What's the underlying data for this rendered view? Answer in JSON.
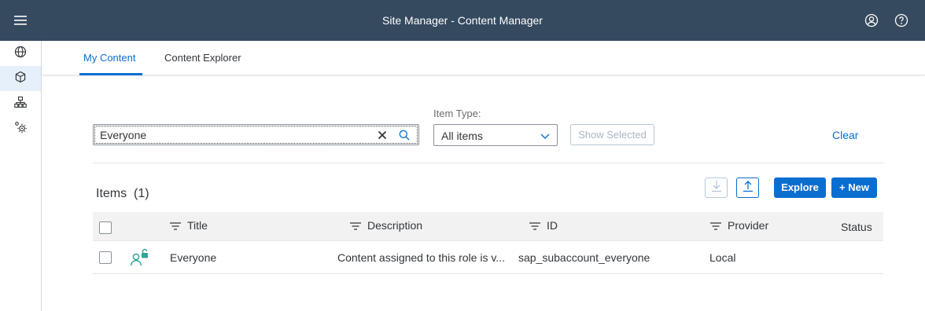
{
  "shell": {
    "title": "Site Manager - Content Manager"
  },
  "sidebar": {
    "items": [
      {
        "icon": "globe-icon",
        "active": false
      },
      {
        "icon": "cube-icon",
        "active": true
      },
      {
        "icon": "org-chart-icon",
        "active": false
      },
      {
        "icon": "settings-icon",
        "active": false
      }
    ]
  },
  "tabs": [
    {
      "label": "My Content",
      "active": true
    },
    {
      "label": "Content Explorer",
      "active": false
    }
  ],
  "filters": {
    "search_value": "Everyone",
    "item_type_label": "Item Type:",
    "item_type_value": "All items",
    "show_selected_label": "Show Selected",
    "clear_label": "Clear"
  },
  "items": {
    "title": "Items",
    "count": "(1)",
    "explore_label": "Explore",
    "new_label": "+ New"
  },
  "table": {
    "columns": [
      "Title",
      "Description",
      "ID",
      "Provider",
      "Status"
    ],
    "rows": [
      {
        "title": "Everyone",
        "description": "Content assigned to this role is v...",
        "id": "sap_subaccount_everyone",
        "provider": "Local",
        "status": ""
      }
    ]
  },
  "colors": {
    "shell": "#354a5f",
    "accent": "#0a6ed1",
    "role_icon": "#2fa59a"
  }
}
